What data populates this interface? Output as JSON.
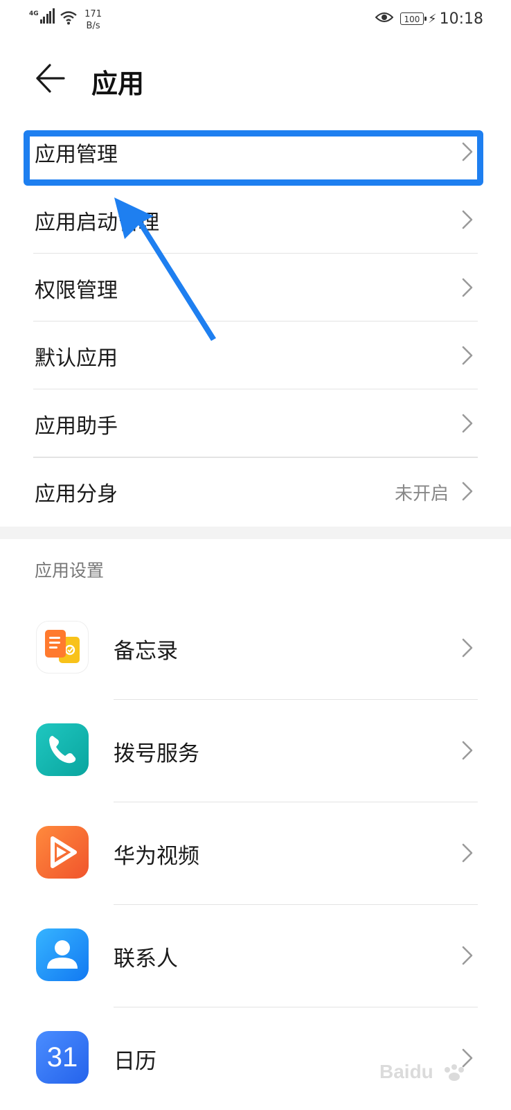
{
  "status_bar": {
    "network_type": "4G",
    "speed_value": "171",
    "speed_unit": "B/s",
    "battery": "100",
    "time": "10:18"
  },
  "header": {
    "title": "应用",
    "back_icon": "arrow-left-icon"
  },
  "menu": {
    "items": [
      {
        "label": "应用管理"
      },
      {
        "label": "应用启动管理"
      },
      {
        "label": "权限管理"
      },
      {
        "label": "默认应用"
      },
      {
        "label": "应用助手"
      },
      {
        "label": "应用分身",
        "value": "未开启"
      }
    ]
  },
  "app_settings": {
    "section_title": "应用设置",
    "apps": [
      {
        "label": "备忘录",
        "icon": "notes-icon"
      },
      {
        "label": "拨号服务",
        "icon": "phone-icon"
      },
      {
        "label": "华为视频",
        "icon": "video-play-icon"
      },
      {
        "label": "联系人",
        "icon": "contacts-icon"
      },
      {
        "label": "日历",
        "icon": "calendar-icon",
        "icon_text": "31"
      }
    ]
  },
  "colors": {
    "annotation_blue": "#1e7ff0",
    "chevron": "#9a9a9a"
  }
}
